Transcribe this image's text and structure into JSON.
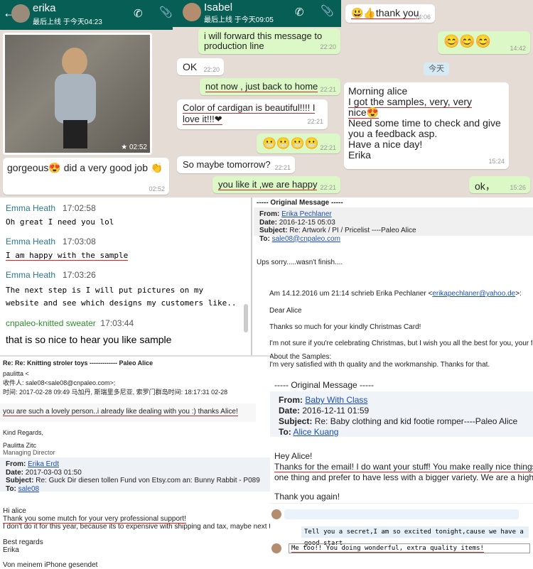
{
  "panel1": {
    "name": "erika",
    "status": "最后上线 于今天04:23",
    "photo_time": "★ 02:52",
    "msg": "gorgeous😍 did a very good job 👏",
    "msg_time": "02:52"
  },
  "panel2": {
    "name": "Isabel",
    "status": "最后上线 于今天09:05",
    "msgs": [
      {
        "t": "i will forward this message to production line",
        "time": "22:20",
        "out": true
      },
      {
        "t": "OK",
        "time": "22:20",
        "out": false
      },
      {
        "t": "not now , just back to home",
        "time": "22:21",
        "out": true
      },
      {
        "t": "Color of cardigan is beautiful!!!! I love it!!!❤",
        "time": "22:21",
        "out": false
      },
      {
        "t": "😬😬😬😬",
        "time": "22:21",
        "out": true
      },
      {
        "t": "So maybe tomorrow?",
        "time": "22:21",
        "out": false
      },
      {
        "t": "you like it ,we are happy",
        "time": "22:21",
        "out": true
      }
    ]
  },
  "panel3": {
    "m1": "😃👍thank you",
    "m1_time": "14:06",
    "m2": "😊😊😊",
    "m2_time": "14:42",
    "date": "今天",
    "m3_l1": "Morning alice",
    "m3_l2": "I got the samples, very, very",
    "m3_l3": "nice😍",
    "m3_l4": "Need some time to check and give",
    "m3_l5": "you a feedback asp.",
    "m3_l6": "Have a nice day!",
    "m3_l7": "Erika",
    "m3_time": "15:24",
    "m4": "ok，",
    "m4_time": "15:26"
  },
  "chat4": [
    {
      "name": "Emma Heath",
      "time": "17:02:58",
      "text": "Oh great I need you lol"
    },
    {
      "name": "Emma Heath",
      "time": "17:03:08",
      "text": "I am happy with the sample"
    },
    {
      "name": "Emma Heath",
      "time": "17:03:26",
      "text": "The next step is I will put pictures on my website and see which designs my customers like.."
    },
    {
      "name": "cnpaleo-knitted sweater",
      "time": "17:03:44",
      "text": "that is so nice to hear  you like sample"
    }
  ],
  "mail5": {
    "header": "----- Original Message -----",
    "from_l": "From:",
    "from": "Erika Pechlaner",
    "date_l": "Date:",
    "date": "2016-12-15 05:03",
    "subj_l": "Subject:",
    "subj": "Re: Artwork / PI / Pricelist ----Paleo Alice",
    "to_l": "To:",
    "to": "sale08@cnpaleo.com",
    "sorry": "Ups sorry.....wasn't finish....",
    "quote_pre": "Am 14.12.2016 um 21:14 schrieb Erika Pechlaner <",
    "quote_mail": "erikapechlaner@yahoo.de",
    "quote_post": ">:",
    "l1": "Dear Alice",
    "l2": "Thanks so much for your kindly Christmas Card!",
    "l3": "I'm not sure if you're celebrating Christmas, but I wish you all the best for you, your family a",
    "l4": "About the Samples:",
    "l5": "I'm very satisfied with th quality and the workmanship. Thanks for that."
  },
  "mail6": {
    "subject": "Re: Re: Knitting stroler toys ------------- Paleo Alice",
    "f1": "paulitta <",
    "f2": "收件人: sale08<sale08@cnpaleo.com>;",
    "f3": "时间: 2017-02-28 09:49   马加丹, 斯瑞里多尼亚, 索罗门群岛时间: 18:17:31 02-28",
    "msg": "you are such a lovely person..i already like dealing with you :) thanks Alice!",
    "kind": "Kind Regards,",
    "sig1": "Paulitta Zitc",
    "sig2": "Managing Director"
  },
  "mail7": {
    "from_l": "From:",
    "from": "Erika Erdt",
    "date_l": "Date:",
    "date": "2017-03-03 01:50",
    "subj_l": "Subject:",
    "subj": "Re: Guck Dir diesen tollen Fund von Etsy.com an: Bunny Rabbit - P089",
    "to_l": "To:",
    "to": "sale08",
    "l1": "Hi alice",
    "l2": "Thank you some mutch for your very professional support!",
    "l3": "I don't do it for this year, because its to expensive with shipping and tax, maybe next time tog",
    "l4": "Best regards",
    "l5": "Erika",
    "l6": "Von meinem iPhone gesendet"
  },
  "mail8": {
    "header": "----- Original Message -----",
    "from_l": "From:",
    "from": "Baby With Class",
    "date_l": "Date:",
    "date": "2016-12-11 01:59",
    "subj_l": "Subject:",
    "subj": "Re: Baby clothing and kid footie romper----Paleo Alice",
    "to_l": "To:",
    "to": "Alice Kuang",
    "l1": "Hey Alice!",
    "l2": "Thanks for the email! I do want your stuff! You make really nice things! E",
    "l3": "one thing and prefer to have less with a bigger variety.  We are a high en",
    "l4": "Thank you again!"
  },
  "chat9": {
    "m1": "Tell you a secret,I am so excited tonight,cause we have a good start",
    "m2": "Me too!! You doing wonderful, extra quality items!"
  }
}
